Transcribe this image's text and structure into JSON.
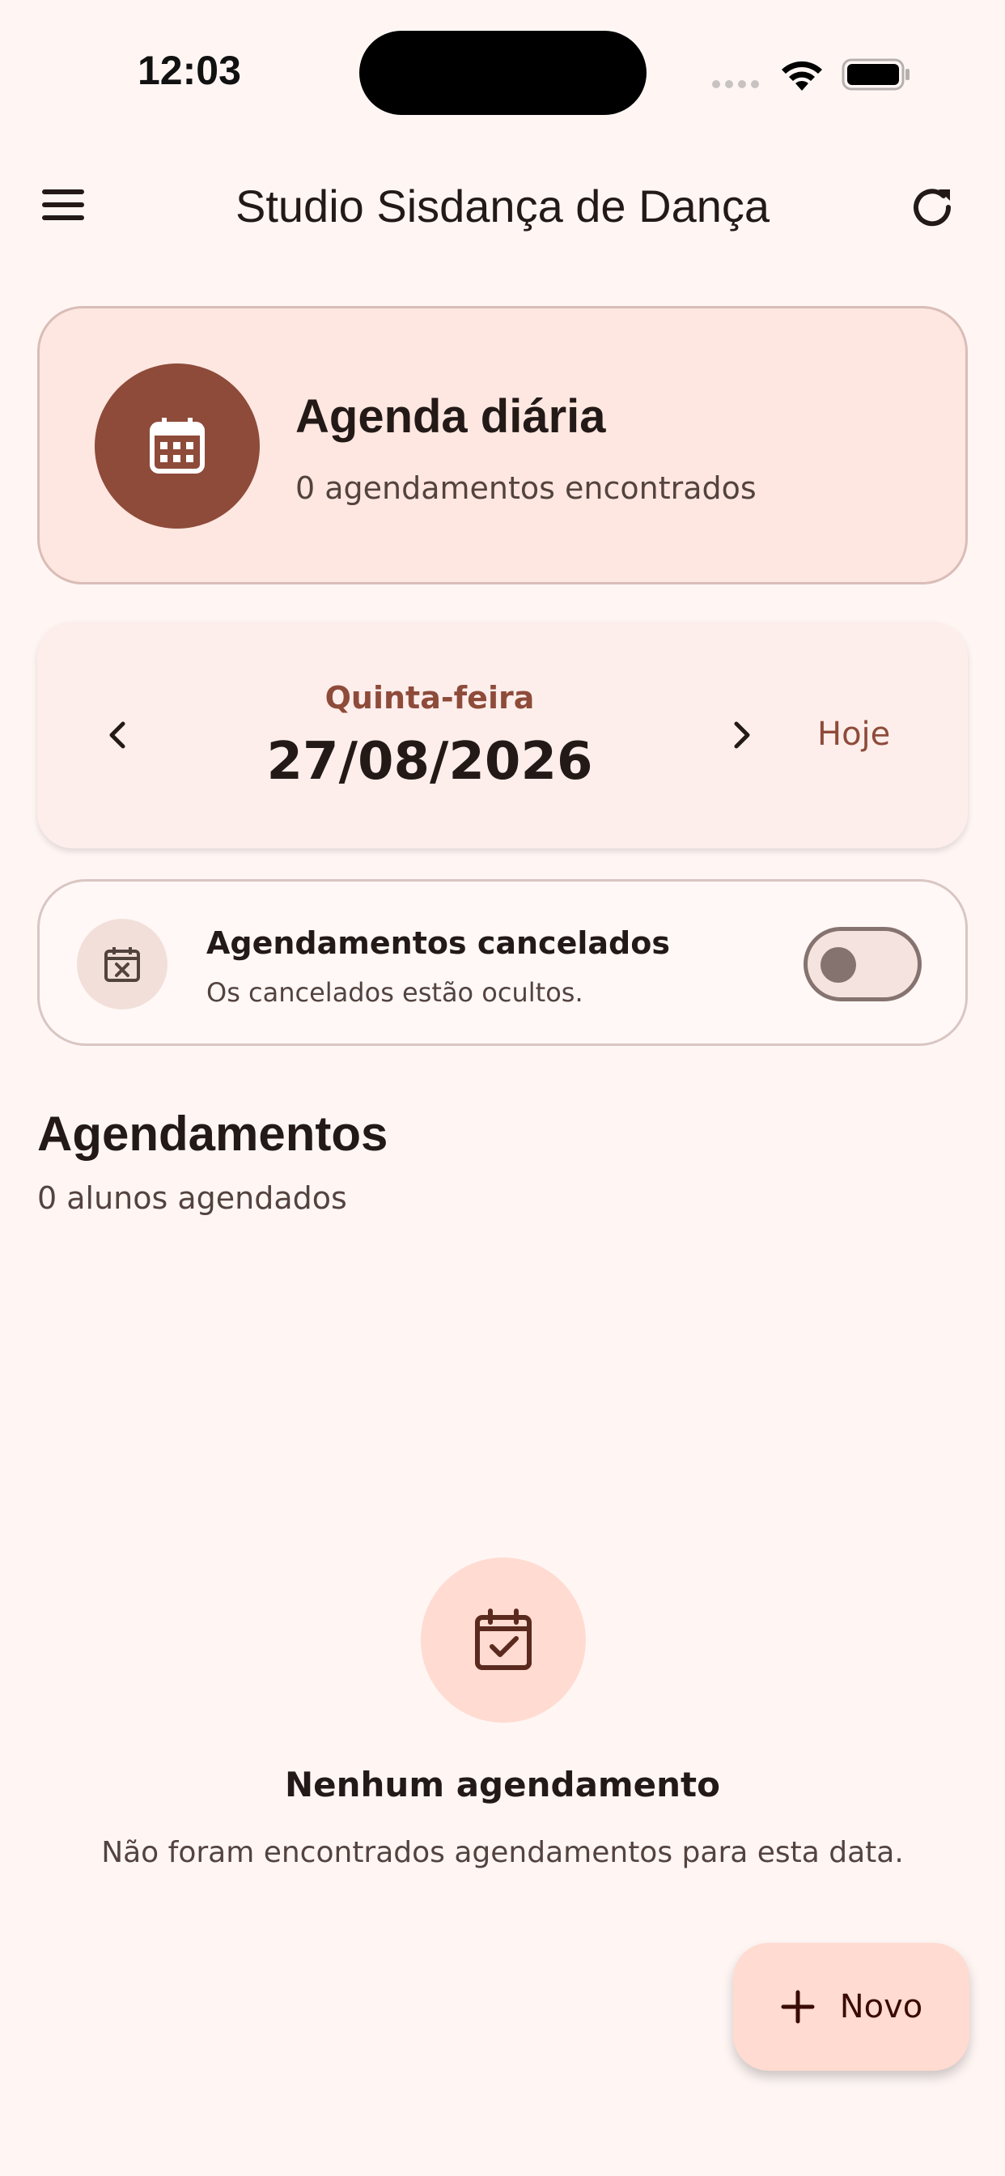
{
  "status_bar": {
    "time": "12:03"
  },
  "app_bar": {
    "title": "Studio Sisdança de Dança",
    "menu_icon": "menu-icon",
    "refresh_icon": "refresh-icon"
  },
  "header_card": {
    "title": "Agenda diária",
    "subtitle": "0 agendamentos encontrados",
    "icon": "calendar-icon"
  },
  "date_nav": {
    "weekday": "Quinta-feira",
    "date": "27/08/2026",
    "today_label": "Hoje"
  },
  "cancelled_filter": {
    "title": "Agendamentos cancelados",
    "subtitle": "Os cancelados estão ocultos.",
    "enabled": false,
    "icon": "calendar-cancel-icon"
  },
  "section": {
    "title": "Agendamentos",
    "subtitle": "0 alunos agendados"
  },
  "empty_state": {
    "title": "Nenhum agendamento",
    "message": "Não foram encontrados agendamentos para esta data.",
    "icon": "calendar-check-icon"
  },
  "fab": {
    "label": "Novo",
    "icon": "plus-icon"
  },
  "colors": {
    "primary": "#8e4b3a",
    "background": "#fff6f4",
    "primary_container": "#ffdbd1"
  }
}
